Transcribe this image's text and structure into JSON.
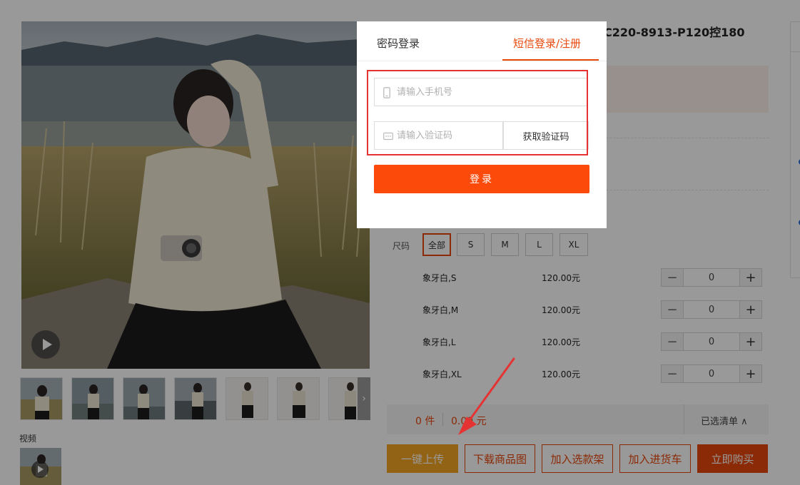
{
  "product": {
    "title": "C220-8913-P120控180",
    "video_label": "视频",
    "size_label": "尺码",
    "sizes": [
      "全部",
      "S",
      "M",
      "L",
      "XL"
    ],
    "active_size": "全部",
    "skus": [
      {
        "name": "象牙白,S",
        "price": "120.00元",
        "qty": "0"
      },
      {
        "name": "象牙白,M",
        "price": "120.00元",
        "qty": "0"
      },
      {
        "name": "象牙白,L",
        "price": "120.00元",
        "qty": "0"
      },
      {
        "name": "象牙白,XL",
        "price": "120.00元",
        "qty": "0"
      }
    ],
    "stepper_minus": "−",
    "stepper_plus": "+",
    "thumb_next": "›"
  },
  "summary": {
    "count": "0 件",
    "amount": "0.00 元",
    "selected_list": "已选清单 ∧"
  },
  "actions": {
    "upload": "一键上传",
    "download": "下载商品图",
    "add_selection": "加入选款架",
    "add_cart": "加入进货车",
    "buy_now": "立即购买"
  },
  "login_modal": {
    "tab_password": "密码登录",
    "tab_sms": "短信登录/注册",
    "phone_placeholder": "请输入手机号",
    "code_placeholder": "请输入验证码",
    "get_code": "获取验证码",
    "login": "登录"
  },
  "colors": {
    "accent": "#e8470a",
    "login_button": "#fc4a0a",
    "upload_button": "#f5a623",
    "highlight_box": "#e53333"
  },
  "icons": {
    "phone": "phone-icon",
    "code": "verification-code-icon",
    "play": "play-icon",
    "arrow": "annotation-arrow"
  }
}
